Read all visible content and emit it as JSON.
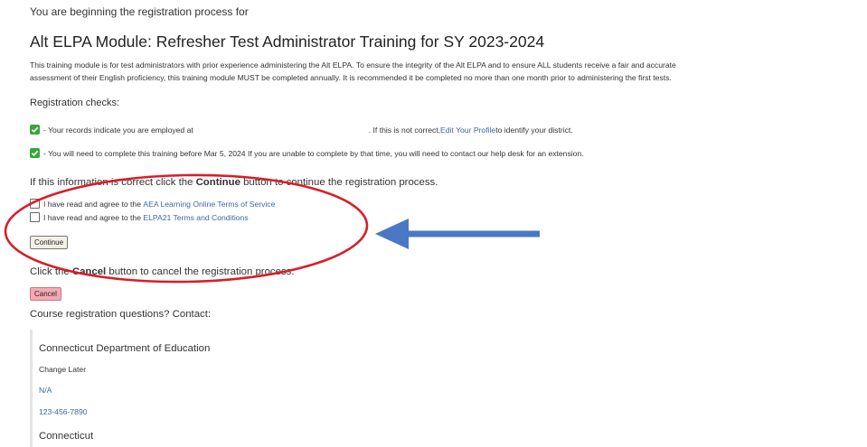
{
  "intro": "You are beginning the registration process for",
  "course_title": "Alt ELPA Module: Refresher Test Administrator Training for SY 2023-2024",
  "description": [
    "This training module is for test administrators with prior experience administering the Alt ELPA. To ensure the integrity of the Alt ELPA and to ensure ALL students receive a fair and accurate",
    "assessment of their English proficiency, this training module MUST be completed annually. It is recommended it be completed no more than one month prior to administering the first tests."
  ],
  "registration_checks": {
    "heading": "Registration checks:",
    "employment": {
      "prefix": "- Your records indicate you are employed at",
      "middle": ". If this is not correct, ",
      "link": "Edit Your Profile",
      "suffix": " to identify your district."
    },
    "deadline": "- You will need to complete this training before Mar 5, 2024 If you are unable to complete by that time, you will need to contact our help desk for an extension."
  },
  "confirm": {
    "before": "If this information is correct click the ",
    "bold": "Continue",
    "after": " button to continue the registration process."
  },
  "agreements": [
    {
      "text": "I have read and agree to the ",
      "link": "AEA Learning Online Terms of Service",
      "checked": false
    },
    {
      "text": "I have read and agree to the ",
      "link": "ELPA21 Terms and Conditions",
      "checked": false
    }
  ],
  "continue_label": "Continue",
  "cancel_message": {
    "before": "Click the ",
    "bold": "Cancel",
    "after": " button to cancel the registration process."
  },
  "cancel_label": "Cancel",
  "questions": "Course registration questions? Contact:",
  "contact": {
    "organization": "Connecticut Department of Education",
    "name": "Change Later",
    "email": "N/A",
    "phone": "123-456-7890",
    "state": "Connecticut"
  },
  "colors": {
    "annotation_red": "#d81e2a",
    "annotation_arrow": "#4a78c4",
    "link": "#3b68a8",
    "check_green": "#3aa53a",
    "cancel_button": "#f4a9b4"
  }
}
